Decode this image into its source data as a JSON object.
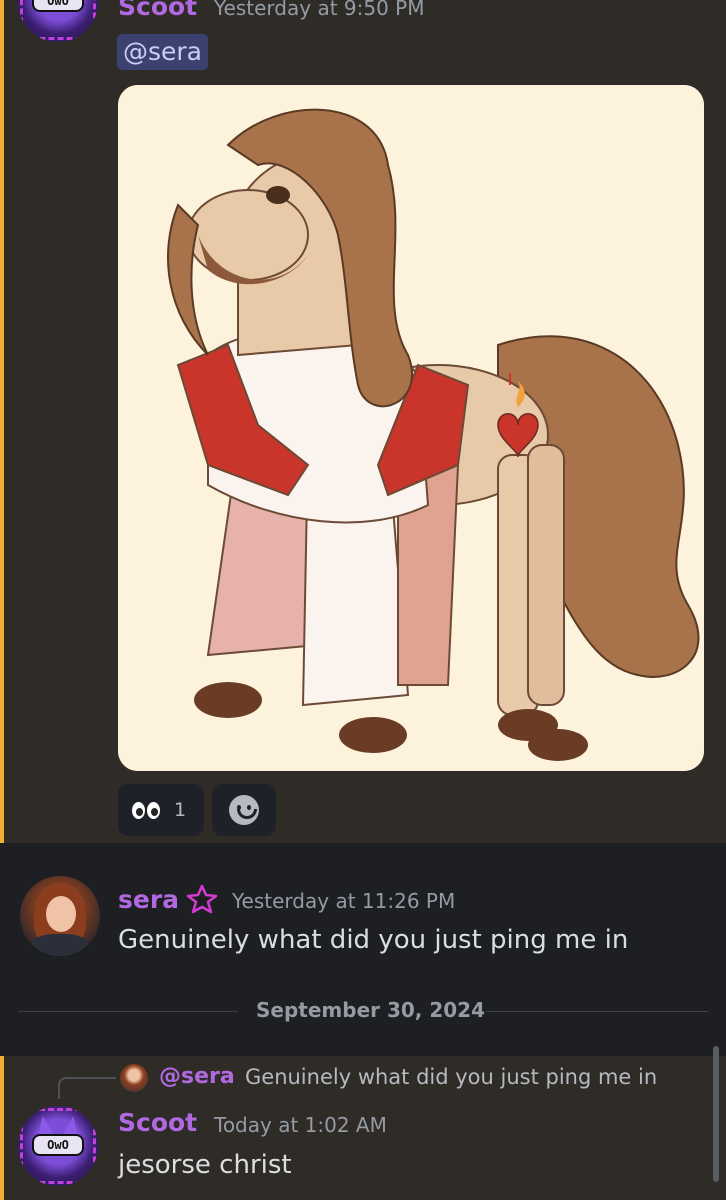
{
  "messages": [
    {
      "author": "Scoot",
      "timestamp": "Yesterday at 9:50 PM",
      "mention": "@sera",
      "reactions": [
        {
          "emoji": "eyes-icon",
          "count": "1"
        }
      ]
    },
    {
      "author": "sera",
      "timestamp": "Yesterday at 11:26 PM",
      "text": "Genuinely what did you just ping me in"
    }
  ],
  "date_divider": "September 30, 2024",
  "reply": {
    "replied_to_name": "@sera",
    "replied_to_text": "Genuinely what did you just ping me in",
    "author": "Scoot",
    "timestamp": "Today at 1:02 AM",
    "text": "jesorse christ"
  },
  "avatar_text": {
    "scoot_face": "OwO"
  },
  "colors": {
    "background": "#1e1f22",
    "highlight": "#2f2c27",
    "highlight_border": "#f0b232",
    "username": "#b069e0",
    "mention_pill": "#3c4270"
  }
}
